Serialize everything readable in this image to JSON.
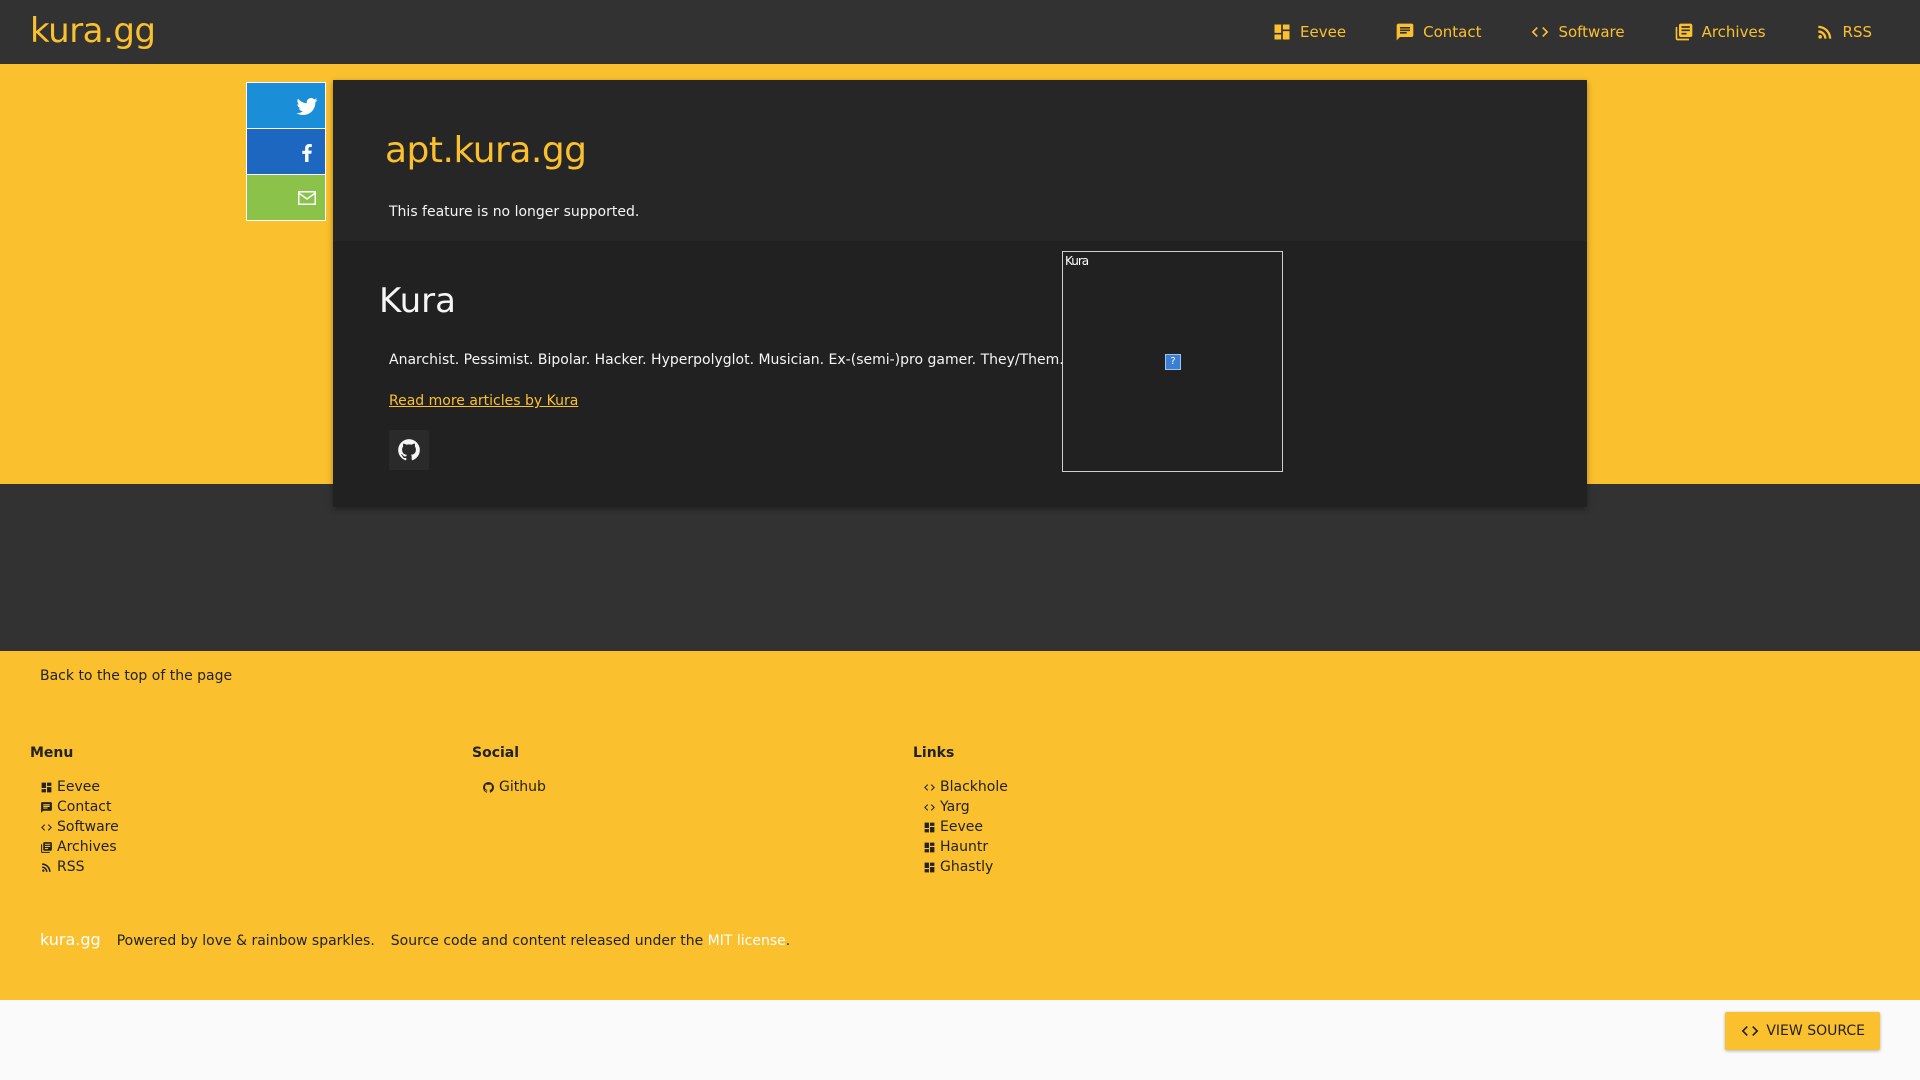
{
  "header": {
    "brand": "kura.gg",
    "nav": [
      {
        "label": "Eevee",
        "icon": "dashboard-icon"
      },
      {
        "label": "Contact",
        "icon": "chat-icon"
      },
      {
        "label": "Software",
        "icon": "code-icon"
      },
      {
        "label": "Archives",
        "icon": "library-icon"
      },
      {
        "label": "RSS",
        "icon": "rss-icon"
      }
    ]
  },
  "share": [
    {
      "network": "twitter",
      "icon": "twitter-icon",
      "color": "#1a8fd8"
    },
    {
      "network": "facebook",
      "icon": "facebook-icon",
      "color": "#1e67c1"
    },
    {
      "network": "email",
      "icon": "mail-icon",
      "color": "#8bc34a"
    }
  ],
  "post": {
    "title": "apt.kura.gg",
    "body": "This feature is no longer supported."
  },
  "author": {
    "name": "Kura",
    "bio": "Anarchist. Pessimist. Bipolar. Hacker. Hyperpolyglot. Musician. Ex-(semi-)pro gamer. They/Them.",
    "more_link": "Read more articles by Kura",
    "avatar_alt": "Kura",
    "social_icon": "github-icon"
  },
  "footer": {
    "back_to_top": "Back to the top of the page",
    "menu": {
      "heading": "Menu",
      "items": [
        {
          "label": "Eevee",
          "icon": "dashboard-icon"
        },
        {
          "label": "Contact",
          "icon": "chat-icon"
        },
        {
          "label": "Software",
          "icon": "code-icon"
        },
        {
          "label": "Archives",
          "icon": "library-icon"
        },
        {
          "label": "RSS",
          "icon": "rss-icon"
        }
      ]
    },
    "social": {
      "heading": "Social",
      "items": [
        {
          "label": "Github",
          "icon": "github-icon"
        }
      ]
    },
    "links": {
      "heading": "Links",
      "items": [
        {
          "label": "Blackhole",
          "icon": "code-icon"
        },
        {
          "label": "Yarg",
          "icon": "code-icon"
        },
        {
          "label": "Eevee",
          "icon": "dashboard-icon"
        },
        {
          "label": "Hauntr",
          "icon": "dashboard-icon"
        },
        {
          "label": "Ghastly",
          "icon": "dashboard-icon"
        }
      ]
    },
    "brand": "kura.gg",
    "powered": "Powered by love & rainbow sparkles.",
    "license_prefix": "Source code and content released under the",
    "license_link": "MIT license",
    "license_suffix": "."
  },
  "view_source": {
    "label": "VIEW SOURCE",
    "icon": "code-icon"
  },
  "colors": {
    "accent": "#fbc02d",
    "dark": "#323232",
    "card": "#212121"
  }
}
